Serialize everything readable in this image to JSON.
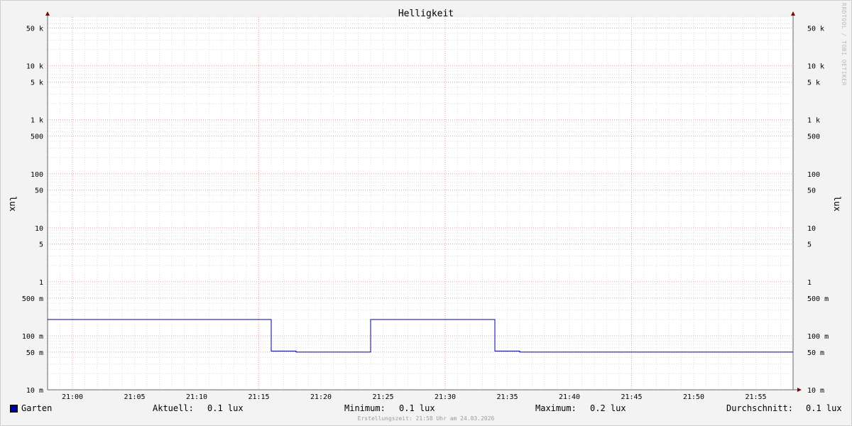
{
  "chart_data": {
    "type": "line",
    "title": "Helligkeit",
    "ylabel": "lux",
    "ylabel_right": "lux",
    "yscale": "log",
    "ylim": [
      0.01,
      80000
    ],
    "xlim": [
      "20:58",
      "21:58"
    ],
    "x_ticks": [
      "21:00",
      "21:05",
      "21:10",
      "21:15",
      "21:20",
      "21:25",
      "21:30",
      "21:35",
      "21:40",
      "21:45",
      "21:50",
      "21:55"
    ],
    "y_ticks": [
      {
        "value": 50000,
        "label": "50 k"
      },
      {
        "value": 10000,
        "label": "10 k"
      },
      {
        "value": 5000,
        "label": "5 k"
      },
      {
        "value": 1000,
        "label": "1 k"
      },
      {
        "value": 500,
        "label": "500"
      },
      {
        "value": 100,
        "label": "100"
      },
      {
        "value": 50,
        "label": "50"
      },
      {
        "value": 10,
        "label": "10"
      },
      {
        "value": 5,
        "label": "5"
      },
      {
        "value": 1,
        "label": "1"
      },
      {
        "value": 0.5,
        "label": "500 m"
      },
      {
        "value": 0.1,
        "label": "100 m"
      },
      {
        "value": 0.05,
        "label": "50 m"
      },
      {
        "value": 0.01,
        "label": "10 m"
      }
    ],
    "grid": true,
    "series": [
      {
        "name": "Garten",
        "color": "#000099",
        "step": true,
        "points": [
          {
            "x": "20:58",
            "y": 0.2
          },
          {
            "x": "21:16",
            "y": 0.052
          },
          {
            "x": "21:18",
            "y": 0.05
          },
          {
            "x": "21:24",
            "y": 0.2
          },
          {
            "x": "21:34",
            "y": 0.052
          },
          {
            "x": "21:36",
            "y": 0.05
          },
          {
            "x": "21:58",
            "y": 0.05
          }
        ]
      }
    ]
  },
  "legend": {
    "series_name": "Garten",
    "current_label": "Aktuell:",
    "current_value": "0.1 lux",
    "min_label": "Minimum:",
    "min_value": "0.1 lux",
    "max_label": "Maximum:",
    "max_value": "0.2 lux",
    "avg_label": "Durchschnitt:",
    "avg_value": "0.1 lux"
  },
  "footer": "Erstellungszeit: 21:58 Uhr am 24.03.2026",
  "watermark": "RRDTOOL / TOBI OETIKER"
}
